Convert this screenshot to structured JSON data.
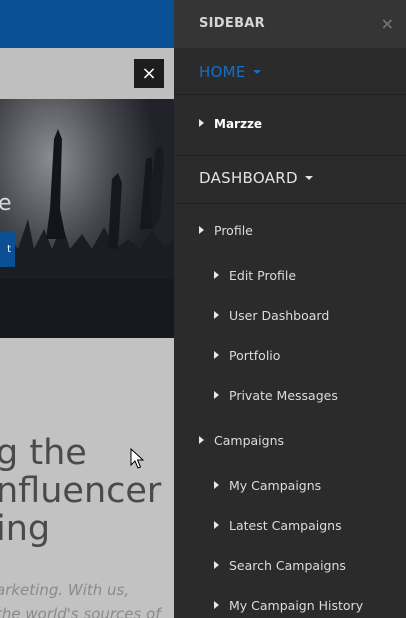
{
  "background": {
    "hero_letter": "e",
    "hero_button": "t",
    "heading_lines": [
      "g the",
      "nfluencer",
      "ing"
    ],
    "body_lines": [
      "arketing. With us,",
      "the world's sources of"
    ],
    "close_symbol": "×"
  },
  "sidebar": {
    "title": "SIDEBAR",
    "close_symbol": "×",
    "home_label": "HOME",
    "sub_home_label": "Marzze",
    "dashboard_label": "DASHBOARD",
    "items": [
      {
        "label": "Profile"
      },
      {
        "label": "Edit Profile"
      },
      {
        "label": "User Dashboard"
      },
      {
        "label": "Portfolio"
      },
      {
        "label": "Private Messages"
      },
      {
        "label": "Campaigns"
      },
      {
        "label": "My Campaigns"
      },
      {
        "label": "Latest Campaigns"
      },
      {
        "label": "Search Campaigns"
      },
      {
        "label": "My Campaign History"
      }
    ]
  },
  "colors": {
    "accent_blue": "#0b4f94",
    "home_link": "#1470c4",
    "sidebar_bg": "#2b2b2b"
  }
}
